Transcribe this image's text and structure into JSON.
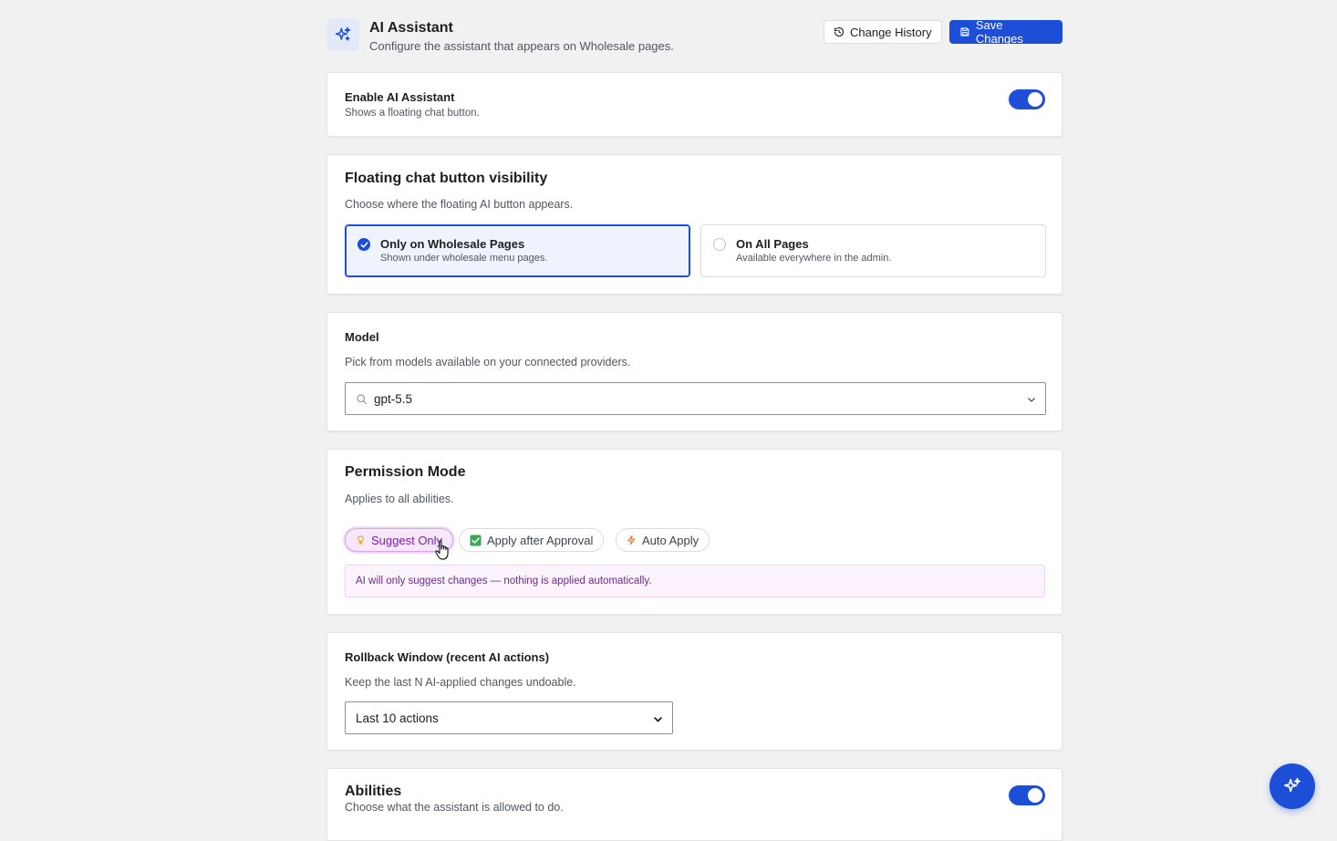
{
  "header": {
    "title": "AI Assistant",
    "subtitle": "Configure the assistant that appears on Wholesale pages.",
    "history_label": "Change History",
    "save_label": "Save Changes"
  },
  "enable": {
    "title": "Enable AI Assistant",
    "description": "Shows a floating chat button.",
    "enabled": true
  },
  "visibility": {
    "title": "Floating chat button visibility",
    "description": "Choose where the floating AI button appears.",
    "options": [
      {
        "label": "Only on Wholesale Pages",
        "sub": "Shown under wholesale menu pages.",
        "selected": true
      },
      {
        "label": "On All Pages",
        "sub": "Available everywhere in the admin.",
        "selected": false
      }
    ]
  },
  "model": {
    "title": "Model",
    "description": "Pick from models available on your connected providers.",
    "value": "gpt-5.5"
  },
  "permission": {
    "title": "Permission Mode",
    "description": "Applies to all abilities.",
    "modes": [
      {
        "label": "Suggest Only",
        "icon": "lightbulb-icon",
        "active": true
      },
      {
        "label": "Apply after Approval",
        "icon": "checkbox-icon",
        "active": false
      },
      {
        "label": "Auto Apply",
        "icon": "lightning-icon",
        "active": false
      }
    ],
    "info": "AI will only suggest changes — nothing is applied automatically."
  },
  "rollback": {
    "title": "Rollback Window (recent AI actions)",
    "description": "Keep the last N AI-applied changes undoable.",
    "value": "Last 10 actions"
  },
  "abilities": {
    "title": "Abilities",
    "description": "Choose what the assistant is allowed to do.",
    "enabled": true
  },
  "colors": {
    "primary": "#1d4ed8",
    "suggest_bg": "#f6e8fa",
    "suggest_text": "#7a1fa2"
  }
}
